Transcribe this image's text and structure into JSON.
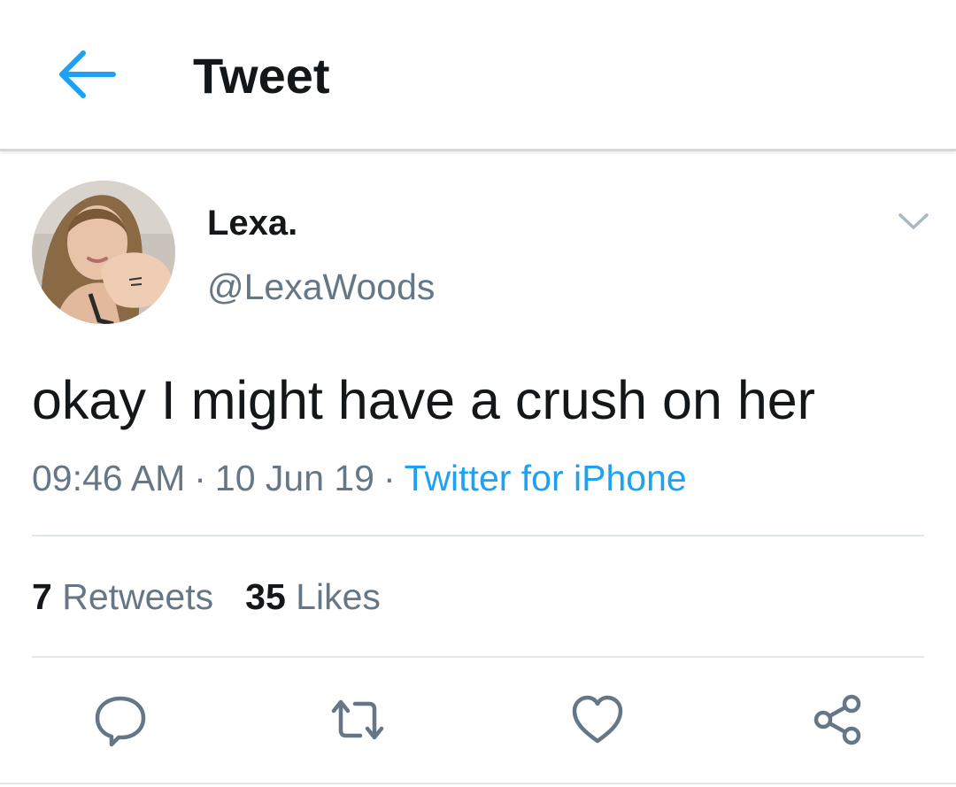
{
  "header": {
    "title": "Tweet",
    "back_icon": "arrow-left-icon"
  },
  "tweet": {
    "author": {
      "display_name": "Lexa.",
      "handle": "@LexaWoods"
    },
    "text": "okay I might have a crush on her",
    "time": "09:46 AM",
    "date": "10 Jun 19",
    "source": "Twitter for iPhone",
    "separator": "·",
    "stats": {
      "retweets_count": "7",
      "retweets_label": "Retweets",
      "likes_count": "35",
      "likes_label": "Likes"
    },
    "actions": [
      "reply-icon",
      "retweet-icon",
      "like-icon",
      "share-icon"
    ]
  },
  "colors": {
    "accent": "#1da1f2",
    "text_primary": "#14171a",
    "text_secondary": "#657786",
    "divider": "#e1e8ed",
    "icon_gray": "#657786"
  }
}
